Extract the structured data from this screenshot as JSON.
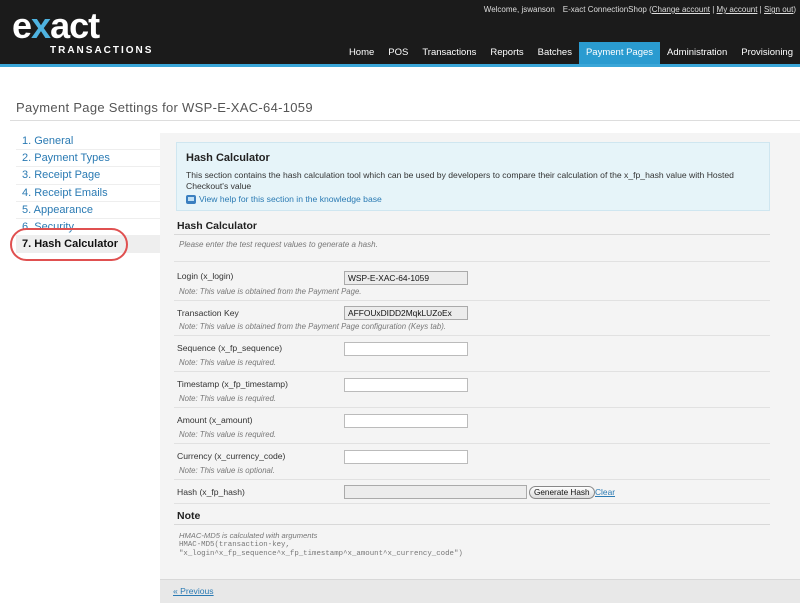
{
  "brand": {
    "name_left": "e",
    "name_mid": "x",
    "name_right": "act",
    "tagline": "TRANSACTIONS"
  },
  "topbar": {
    "welcome": "Welcome, jswanson",
    "shop": "E-xact ConnectionShop (",
    "change_account": "Change account",
    "sep1": " | ",
    "my_account": "My account",
    "sep2": " | ",
    "sign_out": "Sign out",
    "close": ")"
  },
  "nav": {
    "items": [
      "Home",
      "POS",
      "Transactions",
      "Reports",
      "Batches",
      "Payment Pages",
      "Administration",
      "Provisioning"
    ],
    "active_index": 5
  },
  "page_title": "Payment Page Settings for WSP-E-XAC-64-1059",
  "sidebar": {
    "items": [
      {
        "label": "1. General"
      },
      {
        "label": "2. Payment Types"
      },
      {
        "label": "3. Receipt Page"
      },
      {
        "label": "4. Receipt Emails"
      },
      {
        "label": "5. Appearance"
      },
      {
        "label": "6. Security"
      },
      {
        "label": "7. Hash Calculator"
      }
    ],
    "active_index": 6
  },
  "info": {
    "title": "Hash Calculator",
    "text": "This section contains the hash calculation tool which can be used by developers to compare their calculation of the x_fp_hash value with Hosted Checkout's value",
    "help_link": "View help for this section in the knowledge base"
  },
  "form": {
    "section_title": "Hash Calculator",
    "intro": "Please enter the test request values to generate a hash.",
    "login": {
      "label": "Login (x_login)",
      "value": "WSP-E-XAC-64-1059",
      "note": "Note: This value is obtained from the Payment Page."
    },
    "transaction_key": {
      "label": "Transaction Key",
      "value": "AFFOUxDIDD2MqkLUZoEx",
      "note": "Note: This value is obtained from the Payment Page configuration (Keys tab)."
    },
    "sequence": {
      "label": "Sequence (x_fp_sequence)",
      "value": "",
      "note": "Note: This value is required."
    },
    "timestamp": {
      "label": "Timestamp (x_fp_timestamp)",
      "value": "",
      "note": "Note: This value is required."
    },
    "amount": {
      "label": "Amount (x_amount)",
      "value": "",
      "note": "Note: This value is required."
    },
    "currency": {
      "label": "Currency (x_currency_code)",
      "value": "",
      "note": "Note: This value is optional."
    },
    "hash": {
      "label": "Hash (x_fp_hash)",
      "value": "",
      "generate_button": "Generate Hash",
      "clear_link": "Clear"
    }
  },
  "note": {
    "title": "Note",
    "line1": "HMAC-MD5 is calculated with arguments",
    "line2": "HMAC-MD5(transaction-key,",
    "line3": " \"x_login^x_fp_sequence^x_fp_timestamp^x_amount^x_currency_code\")"
  },
  "footer": {
    "previous": "« Previous"
  },
  "colors": {
    "header_bg": "#1b1b1b",
    "accent": "#2a9bd0",
    "link": "#2a7ab3",
    "info_bg": "#e6f4f9",
    "highlight_ring": "#e05050"
  }
}
